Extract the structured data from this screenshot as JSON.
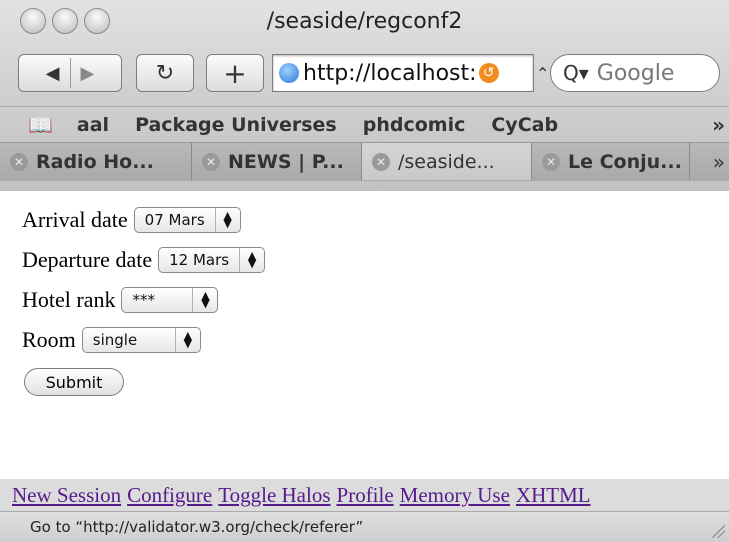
{
  "window": {
    "title": "/seaside/regconf2"
  },
  "toolbar": {
    "back_icon": "◀",
    "forward_icon": "▶",
    "reload_icon": "↻",
    "add_icon": "+",
    "url": "http://localhost:",
    "search_placeholder": "Google",
    "search_icon": "Q▾"
  },
  "bookmarks": {
    "items": [
      "aal",
      "Package Universes",
      "phdcomic",
      "CyCab"
    ],
    "more": "»"
  },
  "tabs": {
    "items": [
      {
        "label": "Radio Ho..."
      },
      {
        "label": "NEWS | P..."
      },
      {
        "label": "/seaside..."
      },
      {
        "label": "Le Conju..."
      }
    ],
    "more": "»"
  },
  "form": {
    "arrival_label": "Arrival date",
    "arrival_value": "07 Mars",
    "departure_label": "Departure date",
    "departure_value": "12 Mars",
    "hotel_label": "Hotel rank",
    "hotel_value": "***",
    "room_label": "Room",
    "room_value": "single",
    "submit_label": "Submit"
  },
  "halo_links": [
    "New Session",
    "Configure",
    "Toggle Halos",
    "Profile",
    "Memory Use",
    "XHTML"
  ],
  "status": {
    "text": "Go to “http://validator.w3.org/check/referer”"
  }
}
